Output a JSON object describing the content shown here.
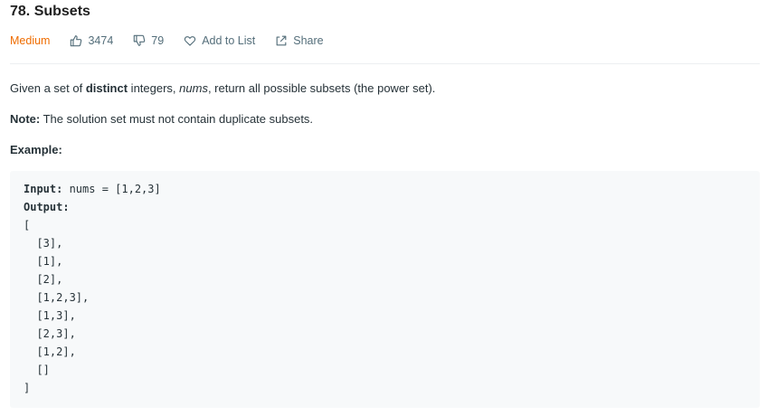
{
  "problem": {
    "title": "78. Subsets",
    "difficulty": "Medium",
    "likes": "3474",
    "dislikes": "79",
    "add_to_list": "Add to List",
    "share": "Share"
  },
  "description": {
    "p1_prefix": "Given a set of ",
    "p1_bold": "distinct",
    "p1_mid": " integers, ",
    "p1_italic": "nums",
    "p1_suffix": ", return all possible subsets (the power set).",
    "note_label": "Note:",
    "note_text": " The solution set must not contain duplicate subsets.",
    "example_label": "Example:"
  },
  "example": {
    "input_label": "Input:",
    "input_value": " nums = [1,2,3]",
    "output_label": "Output:",
    "output_lines": [
      "[",
      "  [3],",
      "  [1],",
      "  [2],",
      "  [1,2,3],",
      "  [1,3],",
      "  [2,3],",
      "  [1,2],",
      "  []",
      "]"
    ]
  },
  "colors": {
    "difficulty_medium": "#ef6c00",
    "meta_text": "#546e7a",
    "code_bg": "#f7f9fa"
  }
}
